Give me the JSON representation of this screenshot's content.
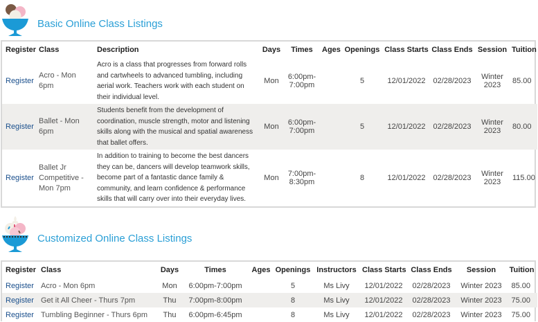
{
  "basic": {
    "title": "Basic Online Class Listings",
    "icon": "ice-cream-sundae-icon",
    "headers": {
      "register": "Register",
      "class": "Class",
      "description": "Description",
      "days": "Days",
      "times": "Times",
      "ages": "Ages",
      "openings": "Openings",
      "class_starts": "Class Starts",
      "class_ends": "Class Ends",
      "session": "Session",
      "tuition": "Tuition"
    },
    "rows": [
      {
        "register": "Register",
        "class": "Acro - Mon 6pm",
        "description": "Acro is a class that progresses from forward rolls and cartwheels to advanced tumbling, including aerial work. Teachers work with each student on their individual level.",
        "days": "Mon",
        "times": "6:00pm-7:00pm",
        "ages": "",
        "openings": "5",
        "class_starts": "12/01/2022",
        "class_ends": "02/28/2023",
        "session": "Winter 2023",
        "tuition": "85.00"
      },
      {
        "register": "Register",
        "class": "Ballet - Mon 6pm",
        "description": "Students benefit from the development of coordination, muscle strength, motor and listening skills along with the musical and spatial awareness that ballet offers.",
        "days": "Mon",
        "times": "6:00pm-7:00pm",
        "ages": "",
        "openings": "5",
        "class_starts": "12/01/2022",
        "class_ends": "02/28/2023",
        "session": "Winter 2023",
        "tuition": "80.00"
      },
      {
        "register": "Register",
        "class": "Ballet Jr Competitive - Mon 7pm",
        "description": "In addition to training to become the best dancers they can be, dancers will develop teamwork skills, become part of a fantastic dance family & community, and learn confidence & performance skills that will carry over into their everyday lives.",
        "days": "Mon",
        "times": "7:00pm-8:30pm",
        "ages": "",
        "openings": "8",
        "class_starts": "12/01/2022",
        "class_ends": "02/28/2023",
        "session": "Winter 2023",
        "tuition": "115.00"
      }
    ]
  },
  "customized": {
    "title": "Customized Online Class Listings",
    "icon": "ice-cream-sundae-sprinkles-icon",
    "headers": {
      "register": "Register",
      "class": "Class",
      "days": "Days",
      "times": "Times",
      "ages": "Ages",
      "openings": "Openings",
      "instructors": "Instructors",
      "class_starts": "Class Starts",
      "class_ends": "Class Ends",
      "session": "Session",
      "tuition": "Tuition"
    },
    "rows": [
      {
        "register": "Register",
        "class": "Acro - Mon 6pm",
        "days": "Mon",
        "times": "6:00pm-7:00pm",
        "ages": "",
        "openings": "5",
        "instructors": "Ms Livy",
        "class_starts": "12/01/2022",
        "class_ends": "02/28/2023",
        "session": "Winter 2023",
        "tuition": "85.00"
      },
      {
        "register": "Register",
        "class": "Get it All Cheer - Thurs 7pm",
        "days": "Thu",
        "times": "7:00pm-8:00pm",
        "ages": "",
        "openings": "8",
        "instructors": "Ms Livy",
        "class_starts": "12/01/2022",
        "class_ends": "02/28/2023",
        "session": "Winter 2023",
        "tuition": "75.00"
      },
      {
        "register": "Register",
        "class": "Tumbling Beginner - Thurs 6pm",
        "days": "Thu",
        "times": "6:00pm-6:45pm",
        "ages": "",
        "openings": "8",
        "instructors": "Ms Livy",
        "class_starts": "12/01/2022",
        "class_ends": "02/28/2023",
        "session": "Winter 2023",
        "tuition": "75.00"
      }
    ]
  },
  "colors": {
    "title": "#2a9fd6",
    "link": "#1a4f8c",
    "row_alt": "#efeeec",
    "border": "#d8d8d8",
    "bowl": "#1b9ad6"
  }
}
